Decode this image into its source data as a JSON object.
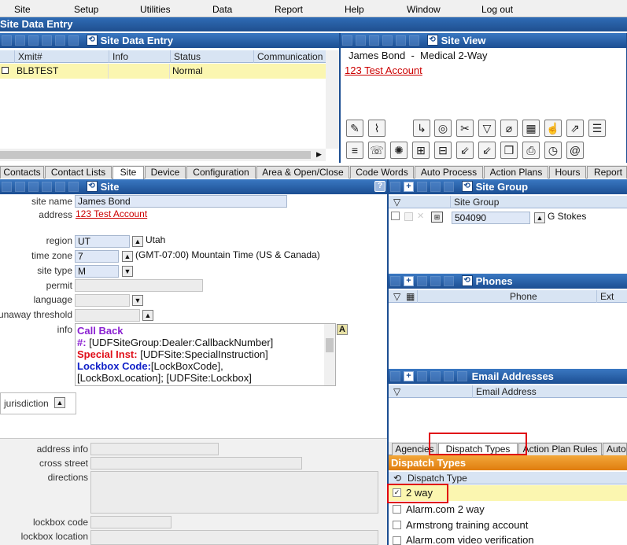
{
  "menu": [
    "Site",
    "Setup",
    "Utilities",
    "Data",
    "Report",
    "Help",
    "Window",
    "Log out"
  ],
  "app_title": "Site Data Entry",
  "left_panel": {
    "title": "Site Data Entry",
    "columns": [
      "Xmit#",
      "Info",
      "Status",
      "Communication"
    ],
    "row": {
      "xmit": "BLBTEST",
      "info": "",
      "status": "Normal"
    }
  },
  "site_view": {
    "title": "Site View",
    "name_line": "James Bond  -  Medical 2-Way",
    "account_link": "123 Test Account"
  },
  "tabs": [
    "Contacts",
    "Contact Lists",
    "Site",
    "Device",
    "Configuration",
    "Area & Open/Close",
    "Code Words",
    "Auto Process",
    "Action Plans",
    "Hours",
    "Report"
  ],
  "site_panel": {
    "title": "Site",
    "help": "?",
    "labels": {
      "site_name": "site name",
      "address": "address",
      "region": "region",
      "time_zone": "time zone",
      "site_type": "site type",
      "permit": "permit",
      "language": "language",
      "runaway": "unaway threshold",
      "info": "info",
      "jurisdiction": "jurisdiction",
      "address_info": "address info",
      "cross_street": "cross street",
      "directions": "directions",
      "lockbox_code": "lockbox code",
      "lockbox_location": "lockbox location"
    },
    "site_name": "James Bond",
    "address": "123 Test Account",
    "region_code": "UT",
    "region_name": "Utah",
    "time_zone_code": "7",
    "time_zone_name": "(GMT-07:00) Mountain Time (US & Canada)",
    "site_type": "M",
    "info_lines": [
      {
        "parts": [
          {
            "t": "Call Back",
            "c": "#8a1fd1",
            "b": true
          }
        ]
      },
      {
        "parts": [
          {
            "t": "#: ",
            "c": "#8a1fd1",
            "b": true
          },
          {
            "t": "[UDFSiteGroup:Dealer:CallbackNumber]",
            "c": "#111",
            "b": false
          }
        ]
      },
      {
        "parts": [
          {
            "t": "Special Inst: ",
            "c": "#e0101a",
            "b": true
          },
          {
            "t": "[UDFSite:SpecialInstruction]",
            "c": "#111",
            "b": false
          }
        ]
      },
      {
        "parts": [
          {
            "t": "Lockbox Code:",
            "c": "#1020c8",
            "b": true
          },
          {
            "t": "[LockBoxCode],",
            "c": "#111",
            "b": false
          }
        ]
      },
      {
        "parts": [
          {
            "t": "[LockBoxLocation]; [UDFSite:Lockbox]",
            "c": "#111",
            "b": false
          }
        ]
      }
    ]
  },
  "site_group": {
    "title": "Site Group",
    "column": "Site Group",
    "value": "504090",
    "name": "G Stokes"
  },
  "phones": {
    "title": "Phones",
    "columns": [
      "Phone",
      "Ext"
    ]
  },
  "email": {
    "title": "Email Addresses",
    "column": "Email Address"
  },
  "bottom_tabs": [
    "Agencies",
    "Dispatch Types",
    "Action Plan Rules",
    "Auto"
  ],
  "dispatch": {
    "title": "Dispatch Types",
    "column": "Dispatch Type",
    "items": [
      {
        "label": "2 way",
        "checked": true
      },
      {
        "label": "Alarm.com 2 way",
        "checked": false
      },
      {
        "label": "Armstrong training account",
        "checked": false
      },
      {
        "label": "Alarm.com video verification",
        "checked": false
      }
    ]
  }
}
